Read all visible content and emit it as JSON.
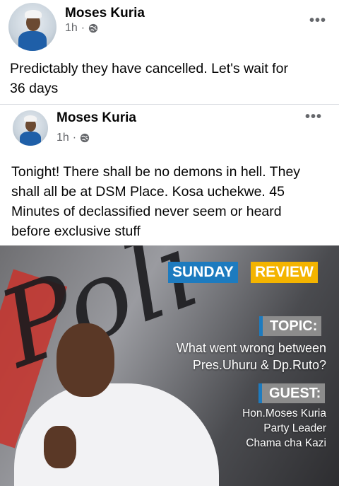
{
  "shared_post": {
    "author": "Moses Kuria",
    "time": "1h",
    "dot": "·",
    "privacy_icon": "globe-icon",
    "more_icon": "•••",
    "text_line1": "Predictably they have cancelled.  Let's wait for",
    "text_line2": "36 days"
  },
  "original_post": {
    "author": "Moses Kuria",
    "time": "1h",
    "dot": "·",
    "privacy_icon": "globe-icon",
    "more_icon": "•••",
    "text_line1": "Tonight! There shall be no demons in hell. They",
    "text_line2": "shall all be at DSM Place. Kosa uchekwe. 45",
    "text_line3": "Minutes of declassified never seem or heard",
    "text_line4": "before exclusive stuff"
  },
  "poster": {
    "background_word": "Poli",
    "sunday": "SUNDAY",
    "review": "REVIEW",
    "topic_label": "TOPIC:",
    "topic_line1": "What went wrong between",
    "topic_line2": "Pres.Uhuru & Dp.Ruto?",
    "guest_label": "GUEST:",
    "guest_name": "Hon.Moses Kuria",
    "guest_title1": "Party Leader",
    "guest_title2": "Chama cha Kazi",
    "colors": {
      "blue": "#1d7bbf",
      "yellow": "#f4b400"
    }
  }
}
